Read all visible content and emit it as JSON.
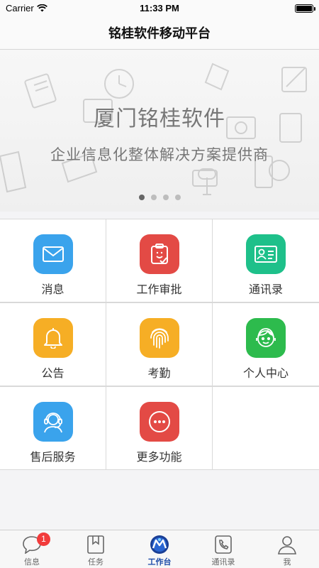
{
  "status_bar": {
    "carrier": "Carrier",
    "time": "11:33 PM",
    "battery_level": 1.0
  },
  "nav": {
    "title": "铭桂软件移动平台"
  },
  "banner": {
    "title": "厦门铭桂软件",
    "subtitle": "企业信息化整体解决方案提供商",
    "page_count": 4,
    "active_index": 0
  },
  "grid": [
    {
      "label": "消息",
      "icon": "mail-icon",
      "color": "#3aa3ec"
    },
    {
      "label": "工作审批",
      "icon": "approval-icon",
      "color": "#e34a45"
    },
    {
      "label": "通讯录",
      "icon": "contact-card-icon",
      "color": "#1ec08a"
    },
    {
      "label": "公告",
      "icon": "bell-icon",
      "color": "#f6ae25"
    },
    {
      "label": "考勤",
      "icon": "fingerprint-icon",
      "color": "#f6ae25"
    },
    {
      "label": "个人中心",
      "icon": "person-face-icon",
      "color": "#2dbb4d"
    },
    {
      "label": "售后服务",
      "icon": "headset-icon",
      "color": "#3aa3ec"
    },
    {
      "label": "更多功能",
      "icon": "more-icon",
      "color": "#e34a45"
    }
  ],
  "tabbar": {
    "active": "工作台",
    "items": [
      {
        "label": "信息",
        "icon": "chat-bubble-icon",
        "badge": "1"
      },
      {
        "label": "任务",
        "icon": "bookmark-icon"
      },
      {
        "label": "工作台",
        "icon": "workbench-logo-icon"
      },
      {
        "label": "通讯录",
        "icon": "phone-icon"
      },
      {
        "label": "我",
        "icon": "user-icon"
      }
    ]
  }
}
